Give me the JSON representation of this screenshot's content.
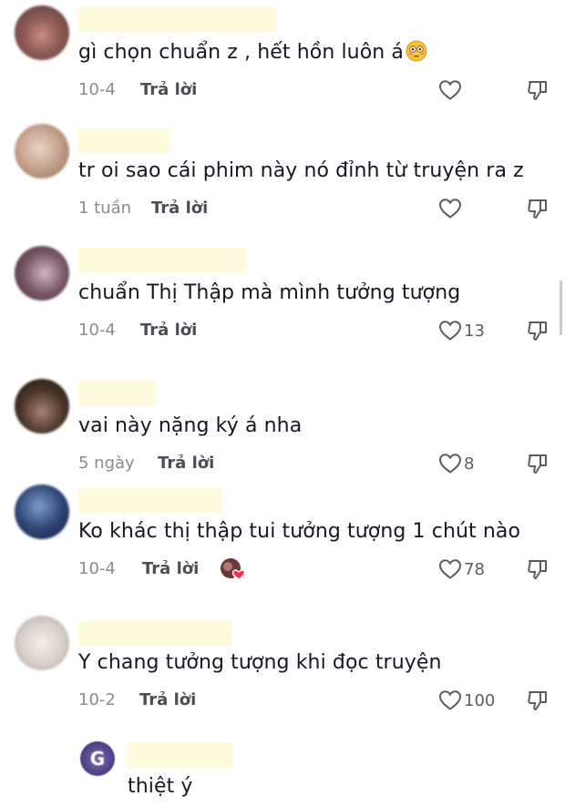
{
  "comments": [
    {
      "text": "gì chọn chuẩn z , hết hồn luôn á",
      "emoji": "flushed-face",
      "date": "10-4",
      "reply": "Trả lời",
      "likes": ""
    },
    {
      "text": "tr oi sao cái phim này nó đỉnh từ truyện ra z",
      "date": "1 tuần",
      "reply": "Trả lời",
      "likes": ""
    },
    {
      "text": "chuẩn Thị Thập mà mình tưởng tượng",
      "date": "10-4",
      "reply": "Trả lời",
      "likes": "13"
    },
    {
      "text": "vai này nặng ký á nha",
      "date": "5 ngày",
      "reply": "Trả lời",
      "likes": "8"
    },
    {
      "text": "Ko khác thị thập tui tưởng tượng 1 chút nào",
      "date": "10-4",
      "reply": "Trả lời",
      "likes": "78",
      "creator_liked": true
    },
    {
      "text": "Y chang tưởng tượng khi đọc truyện",
      "date": "10-2",
      "reply": "Trả lời",
      "likes": "100"
    },
    {
      "text": "thiệt ý",
      "avatar_letter": "G"
    }
  ],
  "icons": {
    "like": "heart-outline-icon",
    "dislike": "thumbs-down-outline-icon"
  },
  "colors": {
    "text": "#161823",
    "meta": "#8a8b91",
    "reply": "#4d4e55",
    "redaction": "#fefbdc",
    "badge_heart": "#fe2c55"
  }
}
